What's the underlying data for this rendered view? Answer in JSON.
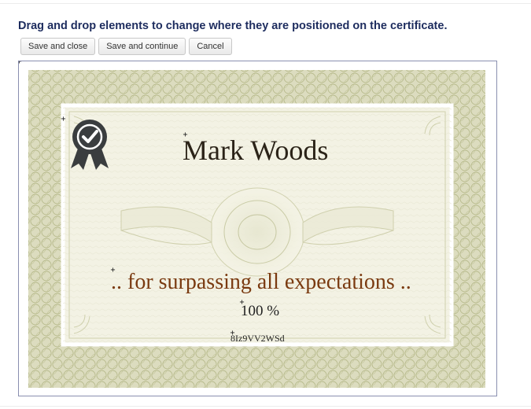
{
  "instructions": "Drag and drop elements to change where they are positioned on the certificate.",
  "buttons": {
    "save_close": "Save and close",
    "save_continue": "Save and continue",
    "cancel": "Cancel"
  },
  "certificate": {
    "name": "Mark Woods",
    "message": ".. for surpassing all expectations ..",
    "grade": "100 %",
    "code": "8Iz9VV2WSd"
  },
  "icons": {
    "badge": "award-ribbon-icon",
    "handle": "move-handle-icon"
  },
  "colors": {
    "instructions": "#1d2c5e",
    "border_ornament": "#c9cba2",
    "paper": "#f3f2e4",
    "message": "#7a3a10",
    "badge": "#3a3d3f"
  }
}
